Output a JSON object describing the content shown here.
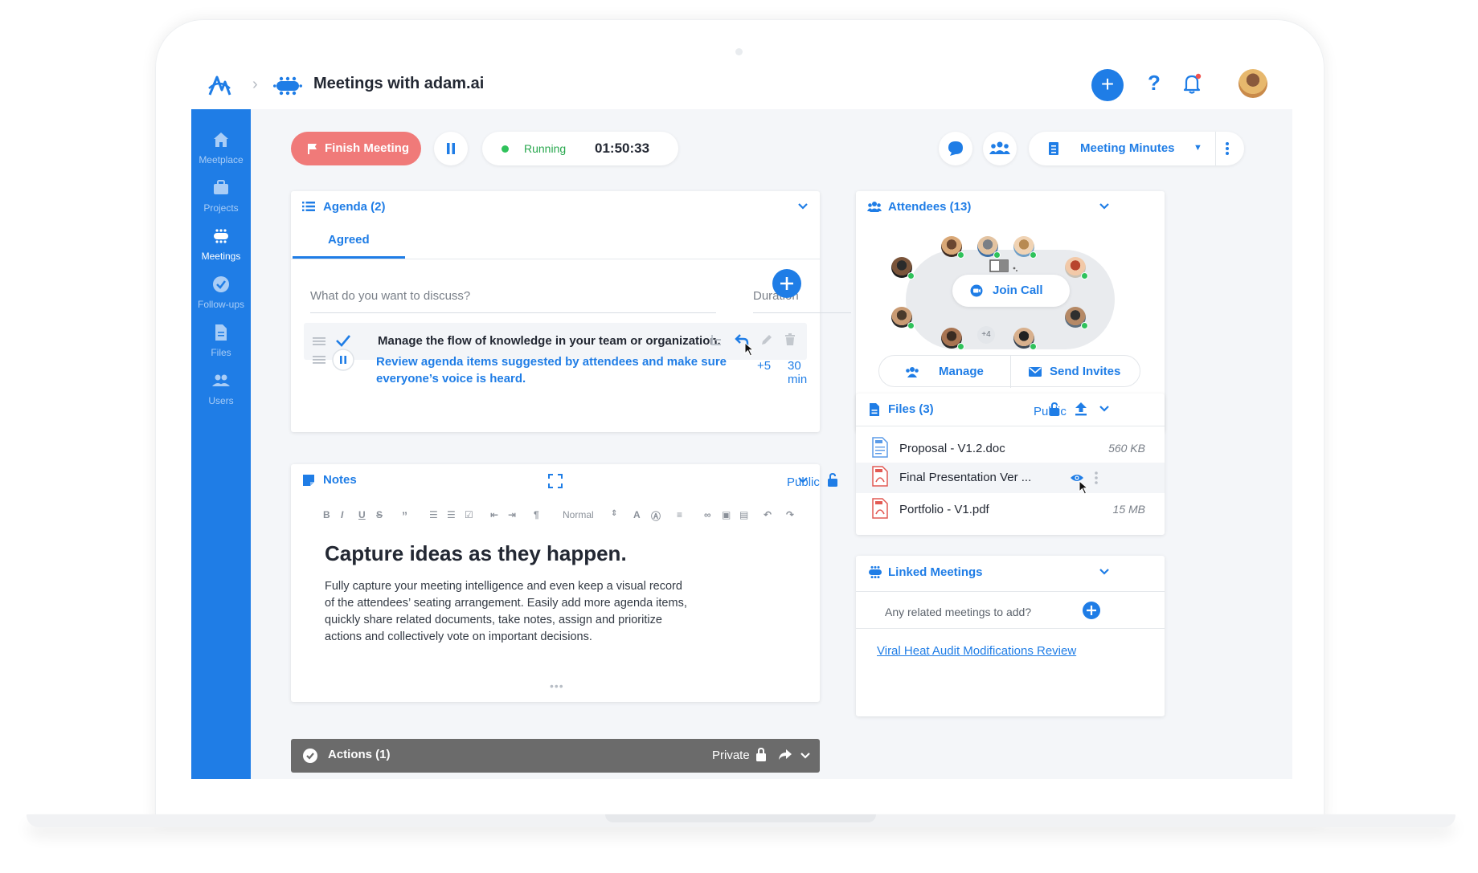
{
  "header": {
    "title": "Meetings with adam.ai",
    "add_label": "+",
    "help_label": "?"
  },
  "sidebar": {
    "items": [
      {
        "label": "Meetplace",
        "icon": "home-icon"
      },
      {
        "label": "Projects",
        "icon": "briefcase-icon"
      },
      {
        "label": "Meetings",
        "icon": "meeting-table-icon"
      },
      {
        "label": "Follow-ups",
        "icon": "check-circle-icon"
      },
      {
        "label": "Files",
        "icon": "file-icon"
      },
      {
        "label": "Users",
        "icon": "users-icon"
      }
    ],
    "active": "Meetings"
  },
  "controls": {
    "finish_label": "Finish Meeting",
    "status": "Running",
    "timer": "01:50:33",
    "minutes_label": "Meeting Minutes"
  },
  "agenda": {
    "title": "Agenda (2)",
    "tab": "Agreed",
    "input_placeholder": "What do you want to discuss?",
    "duration_placeholder": "Duration",
    "items": [
      {
        "text": "Manage the flow of knowledge in your team or organization.",
        "state": "agreed"
      },
      {
        "text": "Review agenda items suggested by attendees and make sure everyone’s voice is heard.",
        "extra": "+5",
        "duration": "30 min",
        "state": "in-progress"
      }
    ]
  },
  "notes": {
    "title": "Notes",
    "visibility": "Public",
    "toolbar": {
      "style_select": "Normal"
    },
    "heading": "Capture ideas as they happen.",
    "body": "Fully capture your meeting intelligence and even keep a visual record of the attendees’ seating arrangement. Easily add more agenda items, quickly share related documents, take notes, assign and prioritize actions and collectively vote on important decisions.",
    "grip": "•••"
  },
  "actions": {
    "title": "Actions (1)",
    "visibility": "Private"
  },
  "attendees": {
    "title": "Attendees (13)",
    "join_label": "Join Call",
    "more_count": "+4",
    "manage_label": "Manage",
    "invite_label": "Send Invites"
  },
  "files": {
    "title": "Files (3)",
    "visibility": "Public",
    "items": [
      {
        "name": "Proposal - V1.2.doc",
        "size": "560 KB",
        "type": "doc"
      },
      {
        "name": "Final Presentation Ver ...",
        "size": "",
        "type": "pdf"
      },
      {
        "name": "Portfolio - V1.pdf",
        "size": "15 MB",
        "type": "pdf"
      }
    ]
  },
  "linked": {
    "title": "Linked Meetings",
    "placeholder": "Any related meetings to add?",
    "link": "Viral Heat Audit Modifications Review"
  },
  "colors": {
    "accent": "#1f7de6",
    "finish": "#f07a79",
    "running": "#2fc25b",
    "actions_bar": "#6b6b6b"
  }
}
